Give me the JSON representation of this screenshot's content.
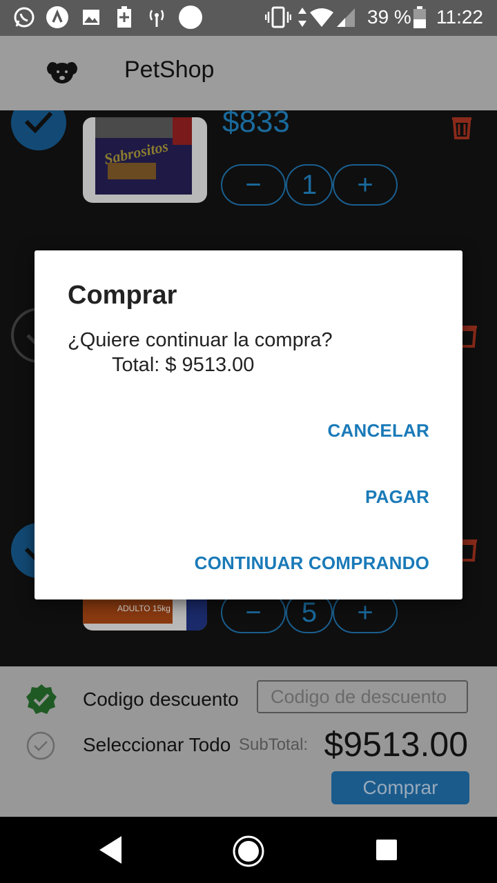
{
  "status_bar": {
    "battery_percent": "39 %",
    "time": "11:22"
  },
  "app_bar": {
    "title": "PetShop",
    "logo_icon": "dog-icon"
  },
  "cart": {
    "items": [
      {
        "price": "$833",
        "quantity": "1"
      },
      {
        "quantity": "5"
      }
    ],
    "decrement_symbol": "−",
    "increment_symbol": "+"
  },
  "dialog": {
    "title": "Comprar",
    "message": "¿Quiere continuar la compra?",
    "total": "Total: $ 9513.00",
    "cancel_label": "CANCELAR",
    "pay_label": "PAGAR",
    "continue_label": "CONTINUAR COMPRANDO"
  },
  "bottom_panel": {
    "discount_label": "Codigo descuento",
    "discount_placeholder": "Codigo de descuento",
    "select_all_label": "Seleccionar Todo",
    "subtotal_label": "SubTotal:",
    "subtotal_value": "$9513.00",
    "buy_label": "Comprar"
  },
  "colors": {
    "accent": "#1a7ab8",
    "discount_check": "#2e7d32",
    "trash": "#c0392b"
  }
}
